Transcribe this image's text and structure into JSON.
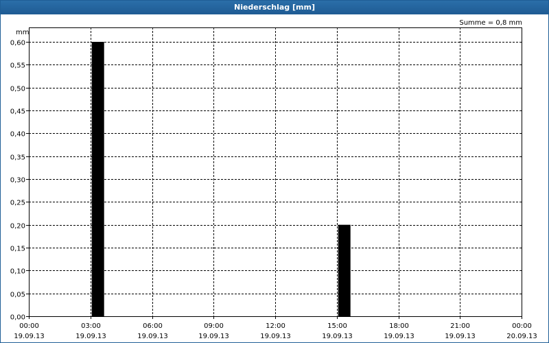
{
  "chart_data": {
    "type": "bar",
    "title": "Niederschlag [mm]",
    "ylabel": "mm",
    "annotation": "Summe = 0,8 mm",
    "ylim": [
      0,
      0.6
    ],
    "yticks": [
      "0,00",
      "0,05",
      "0,10",
      "0,15",
      "0,20",
      "0,25",
      "0,30",
      "0,35",
      "0,40",
      "0,45",
      "0,50",
      "0,55",
      "0,60"
    ],
    "x_range_hours": [
      0,
      24
    ],
    "xticks": [
      {
        "time": "00:00",
        "date": "19.09.13"
      },
      {
        "time": "03:00",
        "date": "19.09.13"
      },
      {
        "time": "06:00",
        "date": "19.09.13"
      },
      {
        "time": "09:00",
        "date": "19.09.13"
      },
      {
        "time": "12:00",
        "date": "19.09.13"
      },
      {
        "time": "15:00",
        "date": "19.09.13"
      },
      {
        "time": "18:00",
        "date": "19.09.13"
      },
      {
        "time": "21:00",
        "date": "19.09.13"
      },
      {
        "time": "00:00",
        "date": "20.09.13"
      }
    ],
    "bars": [
      {
        "start": "19.09.13 03:00",
        "end": "19.09.13 03:40",
        "value": 0.6
      },
      {
        "start": "19.09.13 15:00",
        "end": "19.09.13 15:40",
        "value": 0.2
      }
    ],
    "grid": true,
    "bar_color": "#000000"
  }
}
